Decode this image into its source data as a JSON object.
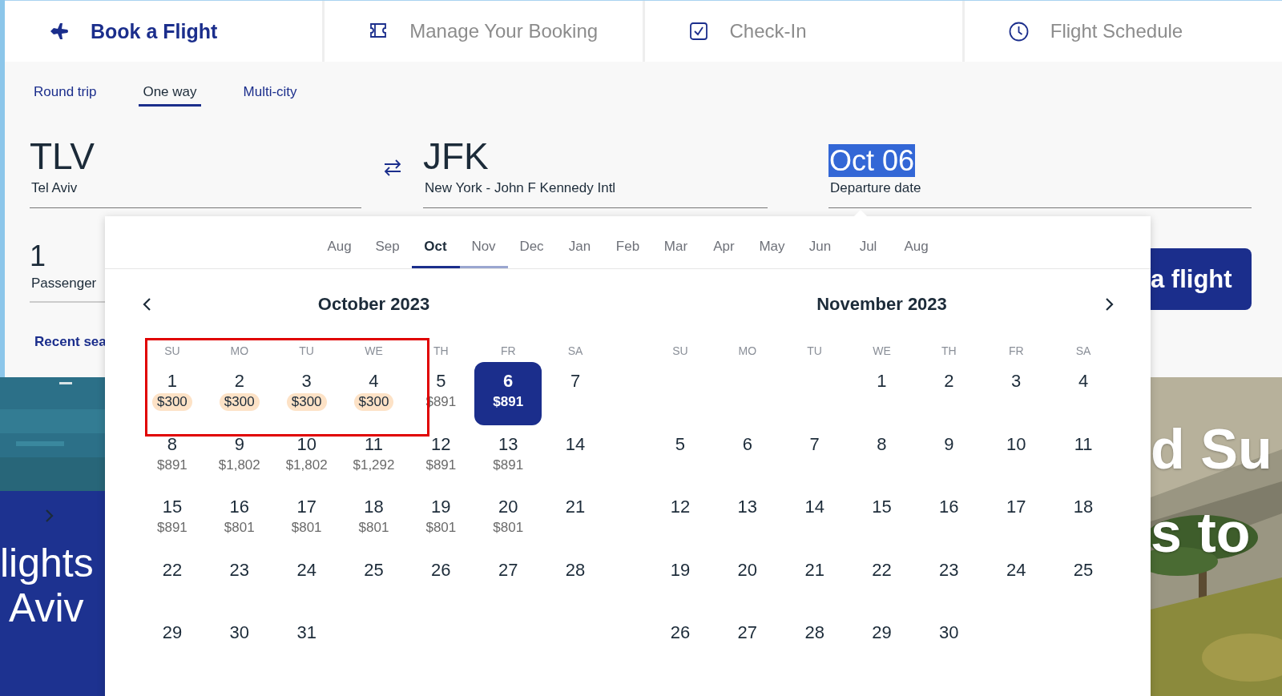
{
  "nav_tabs": [
    {
      "label": "Book a Flight",
      "selected": true
    },
    {
      "label": "Manage Your Booking",
      "selected": false
    },
    {
      "label": "Check-In",
      "selected": false
    },
    {
      "label": "Flight Schedule",
      "selected": false
    }
  ],
  "trip_types": [
    {
      "label": "Round trip",
      "selected": false
    },
    {
      "label": "One way",
      "selected": true
    },
    {
      "label": "Multi-city",
      "selected": false
    }
  ],
  "origin": {
    "code": "TLV",
    "city": "Tel Aviv"
  },
  "destination": {
    "code": "JFK",
    "city": "New York - John F Kennedy Intl"
  },
  "departure": {
    "value": "Oct 06",
    "label": "Departure date",
    "text_selected": true
  },
  "passengers": {
    "value": "1",
    "label": "Passenger"
  },
  "recent_searches": "Recent sea",
  "search_button": "a flight",
  "hero": {
    "left_lines": [
      "lights",
      "Aviv"
    ],
    "right_lines": [
      "d Su",
      "s to"
    ]
  },
  "date_picker": {
    "months": [
      {
        "label": "Aug",
        "selected": false,
        "shown": false
      },
      {
        "label": "Sep",
        "selected": false,
        "shown": false
      },
      {
        "label": "Oct",
        "selected": true,
        "shown": true
      },
      {
        "label": "Nov",
        "selected": false,
        "shown": true
      },
      {
        "label": "Dec",
        "selected": false,
        "shown": false
      },
      {
        "label": "Jan",
        "selected": false,
        "shown": false
      },
      {
        "label": "Feb",
        "selected": false,
        "shown": false
      },
      {
        "label": "Mar",
        "selected": false,
        "shown": false
      },
      {
        "label": "Apr",
        "selected": false,
        "shown": false
      },
      {
        "label": "May",
        "selected": false,
        "shown": false
      },
      {
        "label": "Jun",
        "selected": false,
        "shown": false
      },
      {
        "label": "Jul",
        "selected": false,
        "shown": false
      },
      {
        "label": "Aug",
        "selected": false,
        "shown": false
      }
    ],
    "calendars": [
      {
        "title": "October 2023",
        "weekdays": [
          "SU",
          "MO",
          "TU",
          "WE",
          "TH",
          "FR",
          "SA"
        ],
        "weeks": [
          [
            {
              "day": "1",
              "price": "$300",
              "deal": true,
              "selected": false
            },
            {
              "day": "2",
              "price": "$300",
              "deal": true,
              "selected": false
            },
            {
              "day": "3",
              "price": "$300",
              "deal": true,
              "selected": false
            },
            {
              "day": "4",
              "price": "$300",
              "deal": true,
              "selected": false
            },
            {
              "day": "5",
              "price": "$891",
              "deal": false,
              "selected": false
            },
            {
              "day": "6",
              "price": "$891",
              "deal": false,
              "selected": true
            },
            {
              "day": "7",
              "selected": false
            }
          ],
          [
            {
              "day": "8",
              "price": "$891",
              "deal": false,
              "selected": false
            },
            {
              "day": "9",
              "price": "$1,802",
              "deal": false,
              "selected": false
            },
            {
              "day": "10",
              "price": "$1,802",
              "deal": false,
              "selected": false
            },
            {
              "day": "11",
              "price": "$1,292",
              "deal": false,
              "selected": false
            },
            {
              "day": "12",
              "price": "$891",
              "deal": false,
              "selected": false
            },
            {
              "day": "13",
              "price": "$891",
              "deal": false,
              "selected": false
            },
            {
              "day": "14",
              "selected": false
            }
          ],
          [
            {
              "day": "15",
              "price": "$891",
              "deal": false,
              "selected": false
            },
            {
              "day": "16",
              "price": "$801",
              "deal": false,
              "selected": false
            },
            {
              "day": "17",
              "price": "$801",
              "deal": false,
              "selected": false
            },
            {
              "day": "18",
              "price": "$801",
              "deal": false,
              "selected": false
            },
            {
              "day": "19",
              "price": "$801",
              "deal": false,
              "selected": false
            },
            {
              "day": "20",
              "price": "$801",
              "deal": false,
              "selected": false
            },
            {
              "day": "21",
              "selected": false
            }
          ],
          [
            {
              "day": "22",
              "selected": false
            },
            {
              "day": "23",
              "selected": false
            },
            {
              "day": "24",
              "selected": false
            },
            {
              "day": "25",
              "selected": false
            },
            {
              "day": "26",
              "selected": false
            },
            {
              "day": "27",
              "selected": false
            },
            {
              "day": "28",
              "selected": false
            }
          ],
          [
            {
              "day": "29",
              "selected": false
            },
            {
              "day": "30",
              "selected": false
            },
            {
              "day": "31",
              "selected": false
            }
          ]
        ]
      },
      {
        "title": "November 2023",
        "weekdays": [
          "SU",
          "MO",
          "TU",
          "WE",
          "TH",
          "FR",
          "SA"
        ],
        "weeks": [
          [
            {
              "day": "1",
              "selected": false
            },
            {
              "day": "2",
              "selected": false
            },
            {
              "day": "3",
              "selected": false
            },
            {
              "day": "4",
              "selected": false
            }
          ],
          [
            {
              "day": "5",
              "selected": false
            },
            {
              "day": "6",
              "selected": false
            },
            {
              "day": "7",
              "selected": false
            },
            {
              "day": "8",
              "selected": false
            },
            {
              "day": "9",
              "selected": false
            },
            {
              "day": "10",
              "selected": false
            },
            {
              "day": "11",
              "selected": false
            }
          ],
          [
            {
              "day": "12",
              "selected": false
            },
            {
              "day": "13",
              "selected": false
            },
            {
              "day": "14",
              "selected": false
            },
            {
              "day": "15",
              "selected": false
            },
            {
              "day": "16",
              "selected": false
            },
            {
              "day": "17",
              "selected": false
            },
            {
              "day": "18",
              "selected": false
            }
          ],
          [
            {
              "day": "19",
              "selected": false
            },
            {
              "day": "20",
              "selected": false
            },
            {
              "day": "21",
              "selected": false
            },
            {
              "day": "22",
              "selected": false
            },
            {
              "day": "23",
              "selected": false
            },
            {
              "day": "24",
              "selected": false
            },
            {
              "day": "25",
              "selected": false
            }
          ],
          [
            {
              "day": "26",
              "selected": false
            },
            {
              "day": "27",
              "selected": false
            },
            {
              "day": "28",
              "selected": false
            },
            {
              "day": "29",
              "selected": false
            },
            {
              "day": "30",
              "selected": false
            }
          ]
        ]
      }
    ]
  },
  "annotations": [
    {
      "kind": "rectangle"
    }
  ]
}
